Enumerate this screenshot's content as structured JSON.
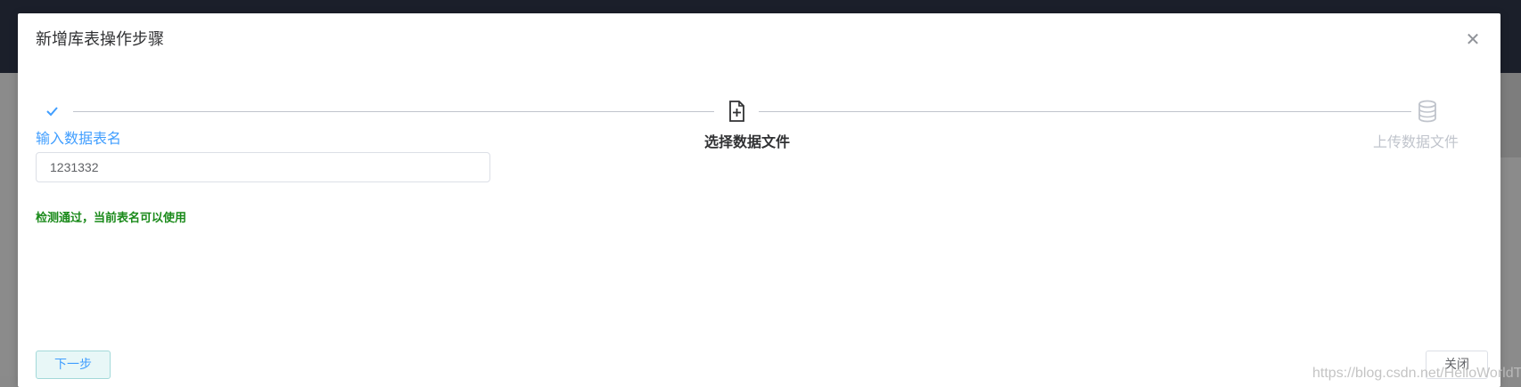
{
  "dialog": {
    "title": "新增库表操作步骤",
    "close_icon": "close-icon"
  },
  "steps": [
    {
      "label": "输入数据表名",
      "icon": "check-icon",
      "status": "finished"
    },
    {
      "label": "选择数据文件",
      "icon": "file-plus-icon",
      "status": "active"
    },
    {
      "label": "上传数据文件",
      "icon": "database-icon",
      "status": "waiting"
    }
  ],
  "form": {
    "table_name_value": "1231332",
    "check_message": "检测通过，当前表名可以使用"
  },
  "footer": {
    "next_label": "下一步",
    "close_label": "关闭"
  },
  "watermark": "https://blog.csdn.net/HelloWorldTom",
  "colors": {
    "primary": "#409eff",
    "success_text": "#1a8a1a",
    "muted": "#c0c4cc",
    "topbar": "#1b1f2a"
  }
}
